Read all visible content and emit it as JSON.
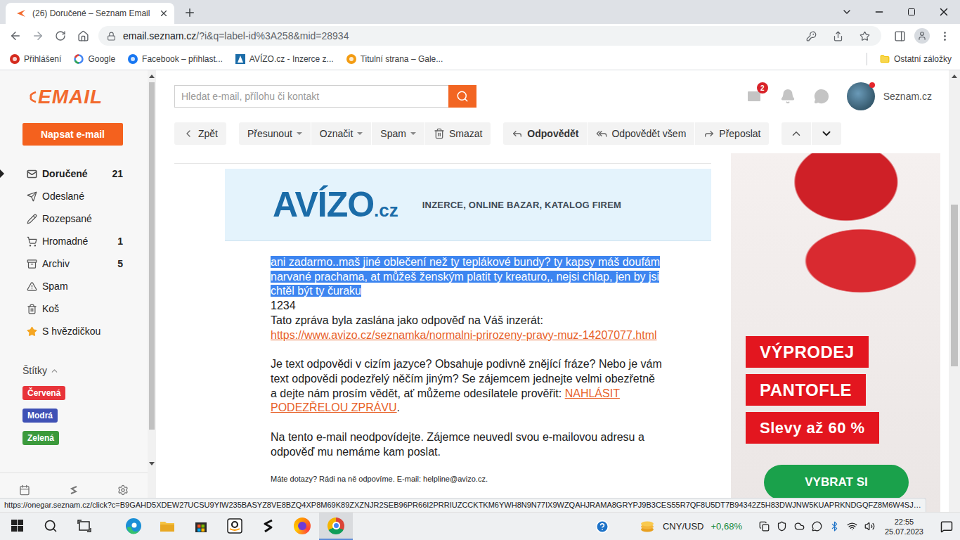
{
  "browser": {
    "tab": {
      "title": "(26) Doručené – Seznam Email",
      "selected": true
    },
    "url": {
      "host": "email.seznam.cz",
      "path": "/?i&q=label-id%3A258&mid=28934"
    },
    "bookmarks": [
      {
        "label": "Přihlášení",
        "kind": "seznam"
      },
      {
        "label": "Google",
        "kind": "google"
      },
      {
        "label": "Facebook – přihlast...",
        "kind": "facebook"
      },
      {
        "label": "AVÍZO.cz - Inzerce z...",
        "kind": "avizo"
      },
      {
        "label": "Titulní strana – Gale...",
        "kind": "gallery"
      }
    ],
    "other_bookmarks": "Ostatní záložky"
  },
  "sidebar": {
    "logo": "EMAIL",
    "compose": "Napsat e-mail",
    "folders": [
      {
        "label": "Doručené",
        "count": "21",
        "kind": "inbox",
        "selected": true
      },
      {
        "label": "Odeslané",
        "count": "",
        "kind": "sent",
        "selected": false
      },
      {
        "label": "Rozepsané",
        "count": "",
        "kind": "drafts",
        "selected": false
      },
      {
        "label": "Hromadné",
        "count": "1",
        "kind": "bulk",
        "selected": false
      },
      {
        "label": "Archiv",
        "count": "5",
        "kind": "archive",
        "selected": false
      },
      {
        "label": "Spam",
        "count": "",
        "kind": "spam",
        "selected": false
      },
      {
        "label": "Koš",
        "count": "",
        "kind": "trash",
        "selected": false
      },
      {
        "label": "S hvězdičkou",
        "count": "",
        "kind": "starred",
        "selected": false
      }
    ],
    "labels_title": "Štítky",
    "labels_expanded": true,
    "labels": [
      {
        "label": "Červená",
        "color": "#e8343a"
      },
      {
        "label": "Modrá",
        "color": "#3f51b5"
      },
      {
        "label": "Zelená",
        "color": "#3c9a3c"
      }
    ]
  },
  "search": {
    "placeholder": "Hledat e-mail, přílohu či kontakt"
  },
  "header": {
    "mail_badge": "2",
    "account": "Seznam.cz",
    "avatar_notification": true
  },
  "toolbar": {
    "groups": [
      [
        {
          "label": "Zpět",
          "kind": "back",
          "dropdown": false,
          "bold": false
        }
      ],
      [
        {
          "label": "Přesunout",
          "kind": "plain",
          "dropdown": true,
          "bold": false
        },
        {
          "label": "Označit",
          "kind": "plain",
          "dropdown": true,
          "bold": false
        },
        {
          "label": "Spam",
          "kind": "plain",
          "dropdown": true,
          "bold": false
        },
        {
          "label": "Smazat",
          "kind": "trash",
          "dropdown": false,
          "bold": false
        }
      ],
      [
        {
          "label": "Odpovědět",
          "kind": "reply",
          "dropdown": false,
          "bold": true
        },
        {
          "label": "Odpovědět všem",
          "kind": "reply-all",
          "dropdown": false,
          "bold": false
        },
        {
          "label": "Přeposlat",
          "kind": "forward",
          "dropdown": false,
          "bold": false
        }
      ]
    ]
  },
  "message": {
    "banner": {
      "logo": "AVÍZO",
      "logo_suffix": ".cz",
      "tagline": "INZERCE, ONLINE BAZAR, KATALOG FIREM"
    },
    "body": {
      "text": "ani zadarmo..maš jiné oblečení než ty teplákové bundy? ty kapsy máš doufám narvané prachama, at můžeš ženským platit ty kreaturo,, nejsi chlap, jen by jsi chtěl být ty čuraku",
      "selected": true
    },
    "code": "1234",
    "intro": "Tato zpráva byla zaslána jako odpověď na Váš inzerát:",
    "link": "https://www.avizo.cz/seznamka/normalni-prirozeny-pravy-muz-14207077.html",
    "warning": {
      "text": "Je text odpovědi v cizím jazyce? Obsahuje podivně znějící fráze? Nebo je vám text odpovědi podezřelý něčím jiným? Se zájemcem jednejte velmi obezřetně a dejte nám prosím vědět, ať můžeme odesílatele prověřit: ",
      "link": "NAHLÁSIT PODEZŘELOU ZPRÁVU",
      "end": "."
    },
    "notice": "Na tento e-mail neodpovídejte. Zájemce neuvedl svou e-mailovou adresu a odpověď mu nemáme kam poslat.",
    "footer": "Máte dotazy? Rádi na ně odpovíme. E-mail: helpline@avizo.cz."
  },
  "ad": {
    "labels": [
      "VÝPRODEJ",
      "PANTOFLE",
      "Slevy až 60 %"
    ],
    "button": "VYBRAT SI"
  },
  "status_url": "https://onegar.seznam.cz/click?c=B9GAHD5XDEW27UCSU9YIW235BASYZ8VE8BZQ4XP8M69K89ZXZNJR2SEB96PR66I2PRRIUZCCKTKM6YWH8N9N77IX9WZQAHJRAMA8GRYPJ9B3CES55R7QF8U5DT7B94342Z5H83DWJNW5KUAPRKNDGQFZ8M6W4SJ…",
  "taskbar": {
    "apps": [
      {
        "kind": "edge",
        "selected": false
      },
      {
        "kind": "explorer",
        "selected": false
      },
      {
        "kind": "store",
        "selected": false
      },
      {
        "kind": "amazon",
        "selected": false
      },
      {
        "kind": "seznam",
        "selected": false
      },
      {
        "kind": "firefox",
        "selected": false
      },
      {
        "kind": "chrome",
        "selected": true
      }
    ],
    "ticker": "CNY/USD",
    "change": "+0,68%",
    "time": "22:55",
    "date": "25.07.2023"
  }
}
